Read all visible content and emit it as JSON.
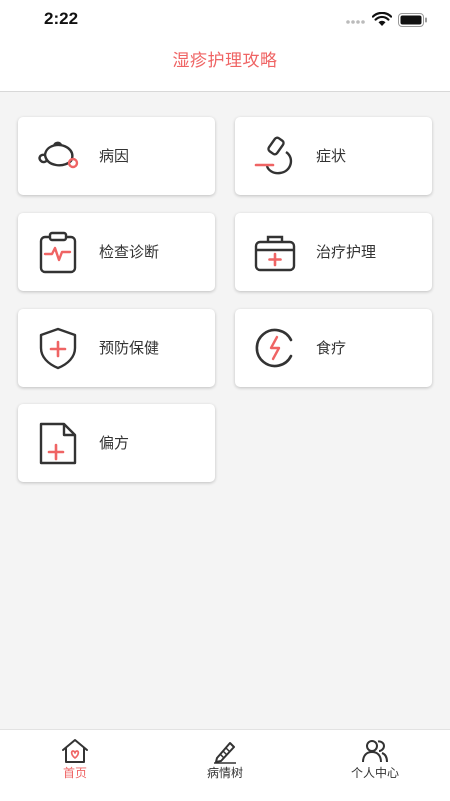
{
  "status_bar": {
    "time": "2:22"
  },
  "header": {
    "title": "湿疹护理攻略"
  },
  "menu": {
    "items": [
      {
        "label": "病因",
        "icon": "teapot-icon"
      },
      {
        "label": "症状",
        "icon": "microscope-icon"
      },
      {
        "label": "检查诊断",
        "icon": "clipboard-pulse-icon"
      },
      {
        "label": "治疗护理",
        "icon": "medical-kit-icon"
      },
      {
        "label": "预防保健",
        "icon": "shield-plus-icon"
      },
      {
        "label": "食疗",
        "icon": "bowl-icon"
      },
      {
        "label": "偏方",
        "icon": "document-plus-icon"
      }
    ]
  },
  "tab_bar": {
    "items": [
      {
        "label": "首页",
        "icon": "home-heart-icon",
        "active": true
      },
      {
        "label": "病情树",
        "icon": "pencil-icon",
        "active": false
      },
      {
        "label": "个人中心",
        "icon": "users-icon",
        "active": false
      }
    ]
  },
  "colors": {
    "accent": "#ef6464",
    "icon_stroke": "#333333",
    "background": "#f4f4f4"
  }
}
